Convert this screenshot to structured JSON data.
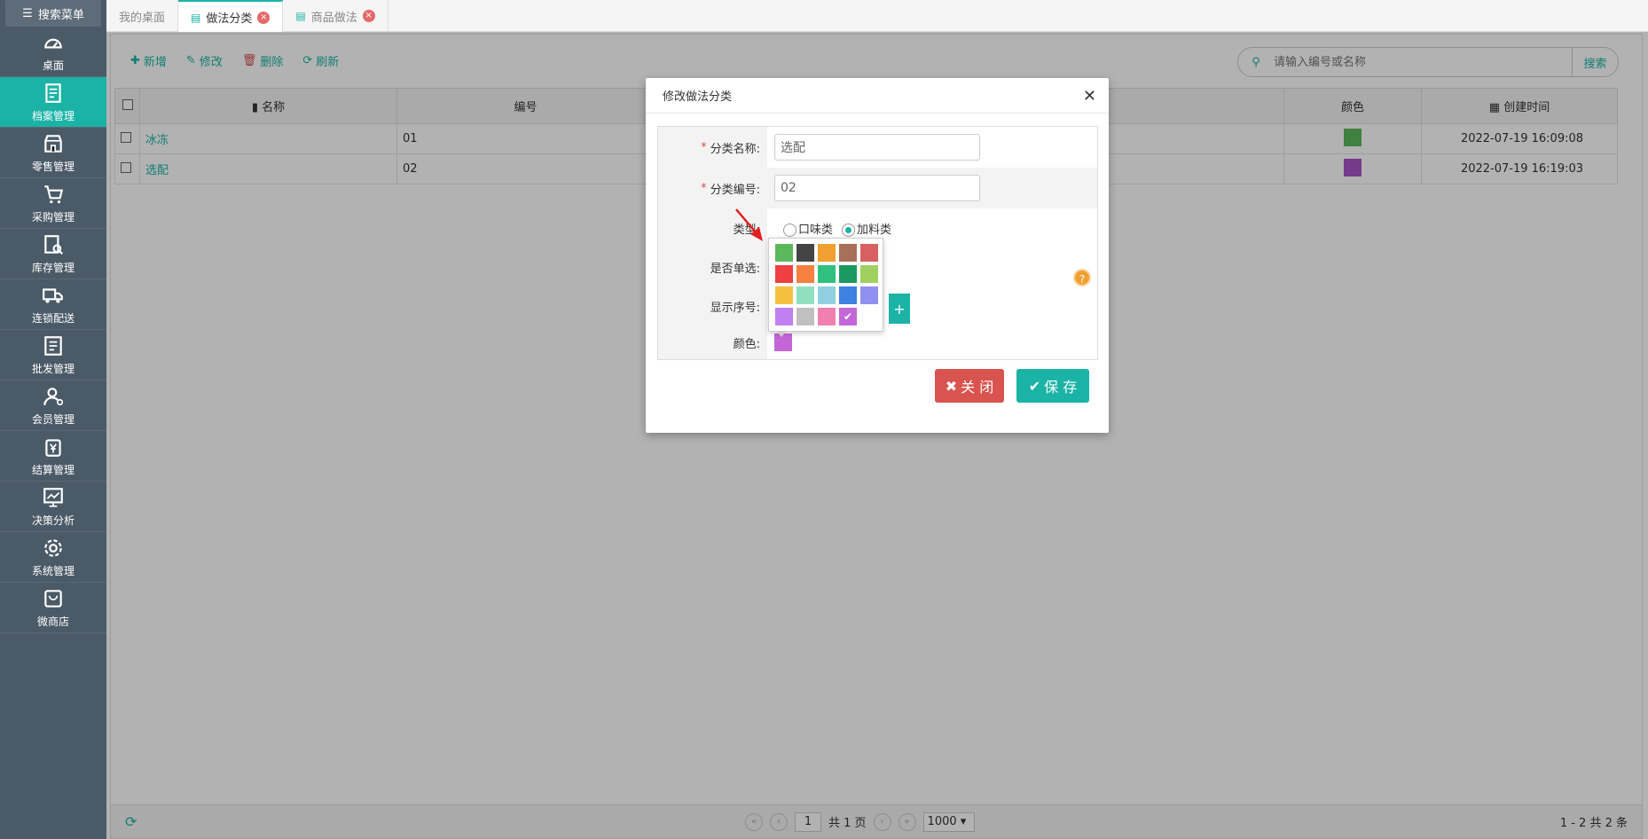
{
  "sidebar": {
    "search_label": "搜索菜单",
    "items": [
      {
        "label": "桌面",
        "icon": "dashboard-icon"
      },
      {
        "label": "档案管理",
        "icon": "archive-icon",
        "active": true
      },
      {
        "label": "零售管理",
        "icon": "store-icon"
      },
      {
        "label": "采购管理",
        "icon": "cart-icon"
      },
      {
        "label": "库存管理",
        "icon": "inventory-icon"
      },
      {
        "label": "连锁配送",
        "icon": "truck-icon"
      },
      {
        "label": "批发管理",
        "icon": "wholesale-icon"
      },
      {
        "label": "会员管理",
        "icon": "member-icon"
      },
      {
        "label": "结算管理",
        "icon": "yen-icon"
      },
      {
        "label": "决策分析",
        "icon": "chart-icon"
      },
      {
        "label": "系统管理",
        "icon": "gear-icon"
      },
      {
        "label": "微商店",
        "icon": "shop-icon"
      }
    ]
  },
  "tabs": [
    {
      "label": "我的桌面",
      "active": false,
      "closable": false
    },
    {
      "label": "做法分类",
      "active": true,
      "closable": true
    },
    {
      "label": "商品做法",
      "active": false,
      "closable": true
    }
  ],
  "toolbar": {
    "add_label": "新增",
    "edit_label": "修改",
    "delete_label": "删除",
    "refresh_label": "刷新"
  },
  "search": {
    "placeholder": "请输入编号或名称",
    "button_label": "搜索"
  },
  "table": {
    "headers": {
      "name": "名称",
      "code": "编号",
      "color": "颜色",
      "created": "创建时间"
    },
    "rows": [
      {
        "name": "冰冻",
        "code": "01",
        "color": "#5cb85c",
        "created": "2022-07-19 16:09:08"
      },
      {
        "name": "选配",
        "code": "02",
        "color": "#a855c8",
        "created": "2022-07-19 16:19:03"
      }
    ]
  },
  "pager": {
    "page": "1",
    "total_pages": "共 1 页",
    "page_size": "1000",
    "info": "1 - 2  共 2 条"
  },
  "dialog": {
    "title": "修改做法分类",
    "fields": {
      "name_label": "分类名称:",
      "name_value": "选配",
      "code_label": "分类编号:",
      "code_value": "02",
      "type_label": "类型:",
      "type_options": [
        "口味类",
        "加料类"
      ],
      "single_label": "是否单选:",
      "order_label": "显示序号:",
      "color_label": "颜色:",
      "color_value": "#c466d8"
    },
    "close_label": "关 闭",
    "save_label": "保 存"
  },
  "palette": {
    "colors": [
      "#5cb85c",
      "#444444",
      "#f0a030",
      "#a87058",
      "#d96060",
      "#ee4040",
      "#f58040",
      "#30c080",
      "#1a9a60",
      "#a0d060",
      "#f5c040",
      "#90e0c0",
      "#90d0e0",
      "#4080e0",
      "#9090f0",
      "#c080f0",
      "#c0c0c0",
      "#f080b0",
      "#c466d8"
    ],
    "selected_index": 18
  }
}
